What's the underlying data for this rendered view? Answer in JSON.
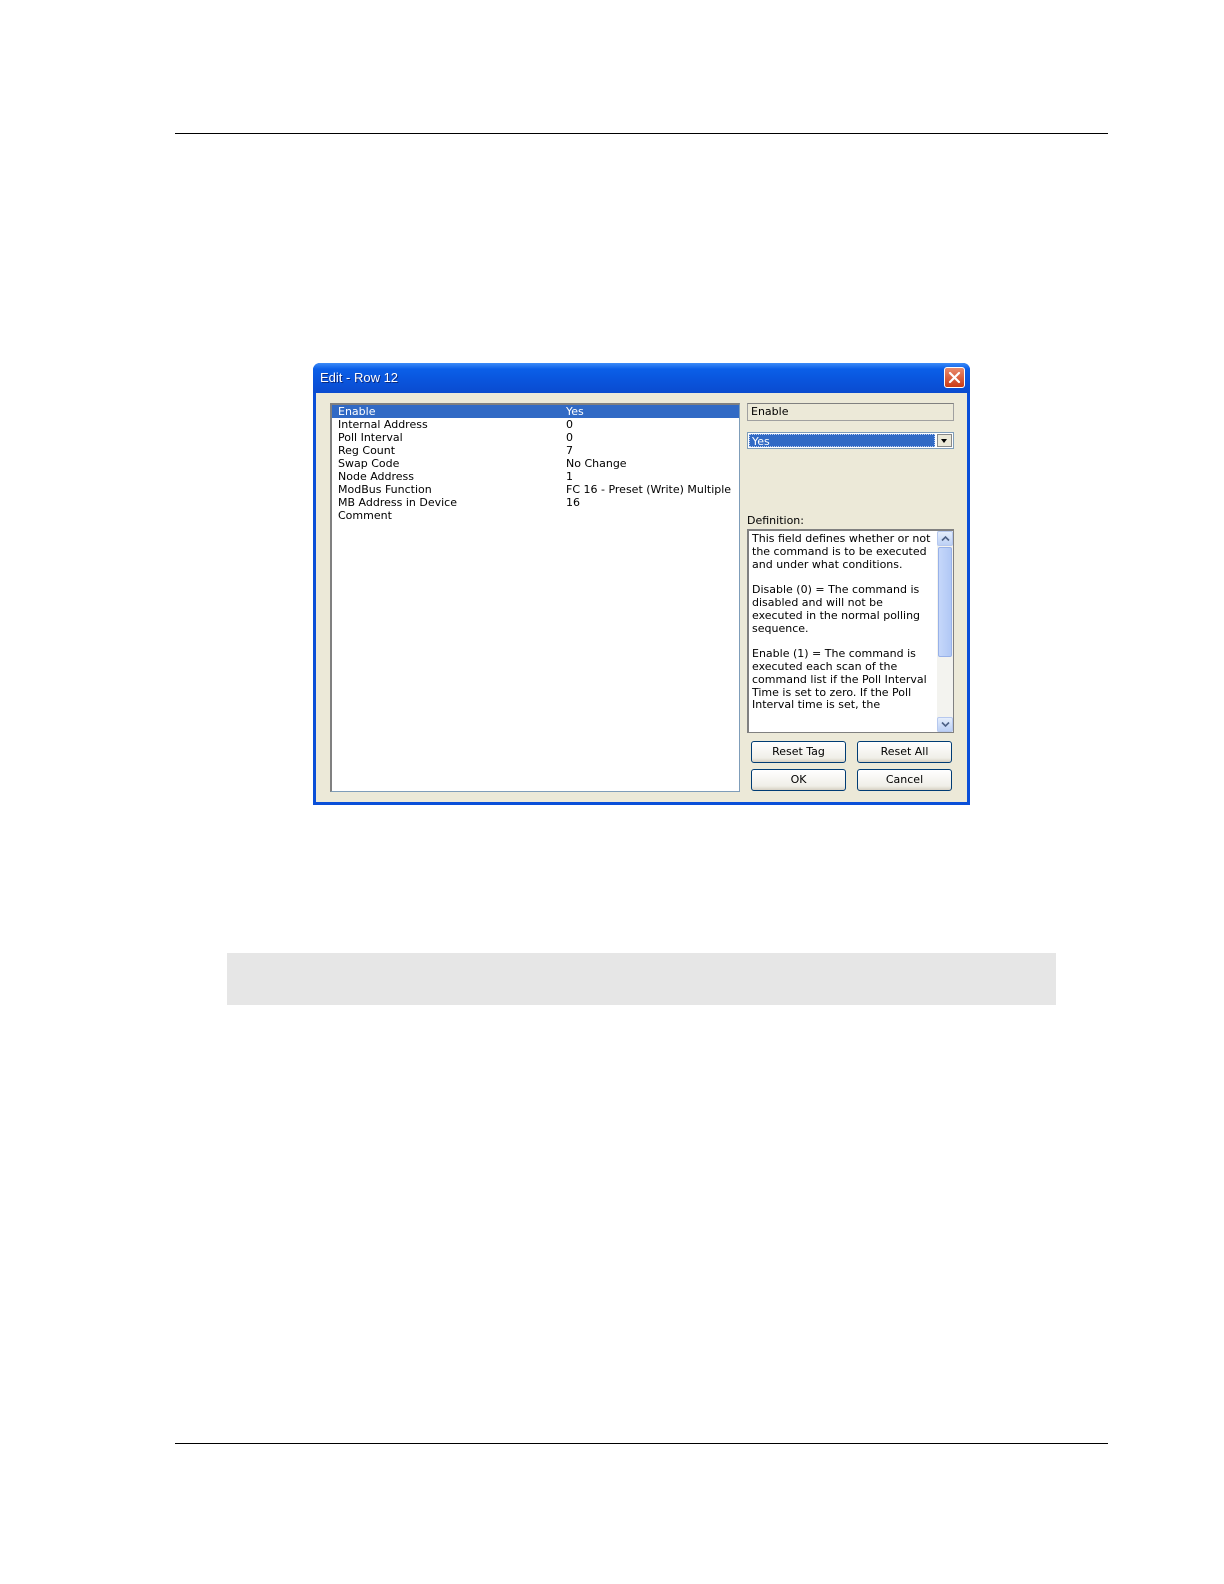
{
  "dialog": {
    "title": "Edit - Row 12"
  },
  "properties": [
    {
      "name": "Enable",
      "value": "Yes",
      "selected": true
    },
    {
      "name": "Internal Address",
      "value": "0"
    },
    {
      "name": "Poll Interval",
      "value": "0"
    },
    {
      "name": "Reg Count",
      "value": "7"
    },
    {
      "name": "Swap Code",
      "value": "No Change"
    },
    {
      "name": "Node Address",
      "value": "1"
    },
    {
      "name": "ModBus Function",
      "value": "FC 16 - Preset (Write) Multiple"
    },
    {
      "name": "MB Address in Device",
      "value": "16"
    },
    {
      "name": "Comment",
      "value": ""
    }
  ],
  "editor": {
    "field_name": "Enable",
    "selected_value": "Yes",
    "definition_label": "Definition:",
    "definition_text": "This field defines whether or not the command is to be executed and under what conditions.\n\nDisable (0) = The command is disabled and will not be executed in the normal polling sequence.\n\nEnable (1) = The command is executed each scan of the command list if the Poll Interval Time is set to zero. If the Poll Interval time is set, the"
  },
  "buttons": {
    "reset_tag": "Reset Tag",
    "reset_all": "Reset All",
    "ok": "OK",
    "cancel": "Cancel"
  },
  "icons": {
    "close": "close-icon",
    "dropdown": "chevron-down-icon",
    "scroll_up": "scroll-up-icon",
    "scroll_down": "scroll-down-icon"
  }
}
